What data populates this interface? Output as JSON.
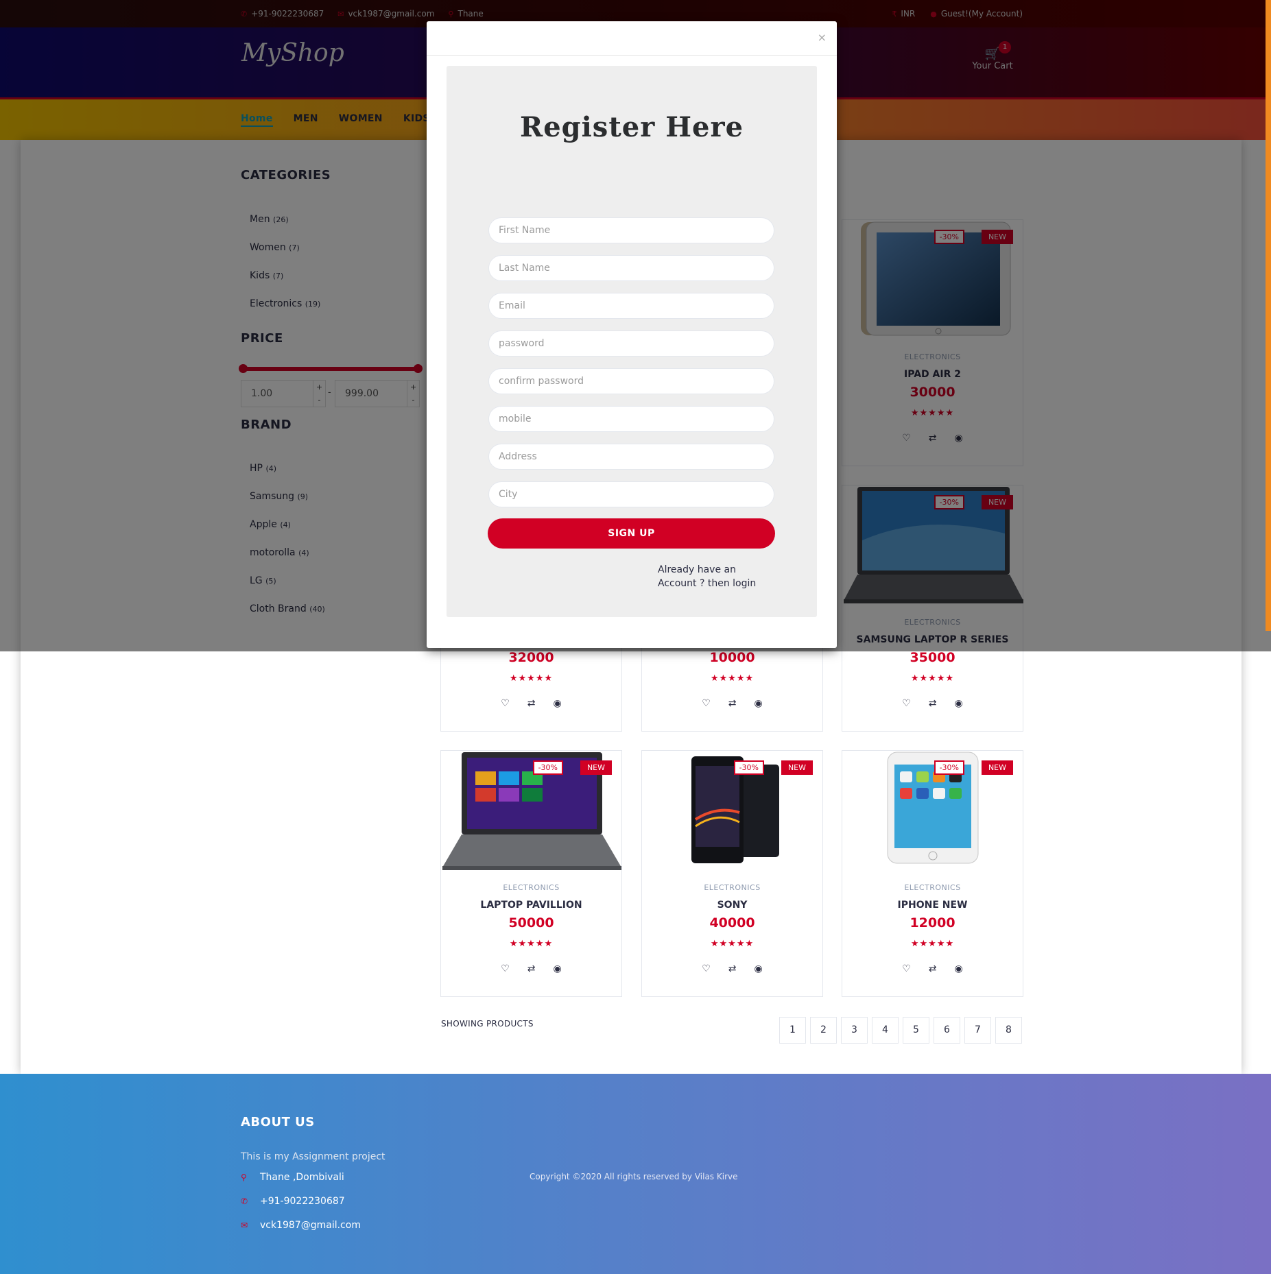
{
  "topbar": {
    "phone": "+91-9022230687",
    "email": "vck1987@gmail.com",
    "location": "Thane",
    "currency": "INR",
    "account": "Guest!(My Account)"
  },
  "header": {
    "logo": "MyShop",
    "cart_label": "Your Cart",
    "cart_qty": "1"
  },
  "nav": {
    "items": [
      "Home",
      "MEN",
      "WOMEN",
      "KIDS"
    ]
  },
  "sidebar": {
    "categories_title": "CATEGORIES",
    "categories": [
      {
        "name": "Men",
        "count": "(26)"
      },
      {
        "name": "Women",
        "count": "(7)"
      },
      {
        "name": "Kids",
        "count": "(7)"
      },
      {
        "name": "Electronics",
        "count": "(19)"
      }
    ],
    "price_title": "PRICE",
    "price_min": "1.00",
    "price_max": "999.00",
    "brand_title": "BRAND",
    "brands": [
      {
        "name": "HP",
        "count": "(4)"
      },
      {
        "name": "Samsung",
        "count": "(9)"
      },
      {
        "name": "Apple",
        "count": "(4)"
      },
      {
        "name": "motorolla",
        "count": "(4)"
      },
      {
        "name": "LG",
        "count": "(5)"
      },
      {
        "name": "Cloth Brand",
        "count": "(40)"
      }
    ]
  },
  "products": [
    {
      "category": "ELECTRONICS",
      "name": "IPAD AIR 2",
      "price": "30000",
      "discount": "-30%",
      "badge": "NEW",
      "stars": "★★★★★"
    },
    {
      "category": "ELECTRONICS",
      "name": "SAMSUNG LAPTOP R SERIES",
      "price": "35000",
      "discount": "-30%",
      "badge": "NEW",
      "stars": "★★★★★"
    },
    {
      "category": "",
      "name": "",
      "price": "32000",
      "discount": "",
      "badge": "",
      "stars": "★★★★★"
    },
    {
      "category": "",
      "name": "",
      "price": "10000",
      "discount": "",
      "badge": "",
      "stars": "★★★★★"
    },
    {
      "category": "ELECTRONICS",
      "name": "LAPTOP PAVILLION",
      "price": "50000",
      "discount": "-30%",
      "badge": "NEW",
      "stars": "★★★★★"
    },
    {
      "category": "ELECTRONICS",
      "name": "SONY",
      "price": "40000",
      "discount": "-30%",
      "badge": "NEW",
      "stars": "★★★★★"
    },
    {
      "category": "ELECTRONICS",
      "name": "IPHONE NEW",
      "price": "12000",
      "discount": "-30%",
      "badge": "NEW",
      "stars": "★★★★★"
    }
  ],
  "card_icons": {
    "wishlist": "♡",
    "compare": "⇄",
    "view": "◉"
  },
  "showing": "SHOWING PRODUCTS",
  "pages": [
    "1",
    "2",
    "3",
    "4",
    "5",
    "6",
    "7",
    "8"
  ],
  "footer": {
    "title": "ABOUT US",
    "about": "This is my Assignment project",
    "address": "Thane ,Dombivali",
    "phone": "+91-9022230687",
    "email": "vck1987@gmail.com",
    "copyright": "Copyright ©2020 All rights reserved by Vilas Kirve"
  },
  "modal": {
    "close": "×",
    "title": "Register Here",
    "placeholders": {
      "first_name": "First Name",
      "last_name": "Last Name",
      "email": "Email",
      "password": "password",
      "confirm_password": "confirm password",
      "mobile": "mobile",
      "address": "Address",
      "city": "City"
    },
    "signup": "SIGN UP",
    "login_text": "Already have an Account ? then login"
  },
  "colors": {
    "primary": "#D10024",
    "nav_active": "#15a0b8"
  }
}
